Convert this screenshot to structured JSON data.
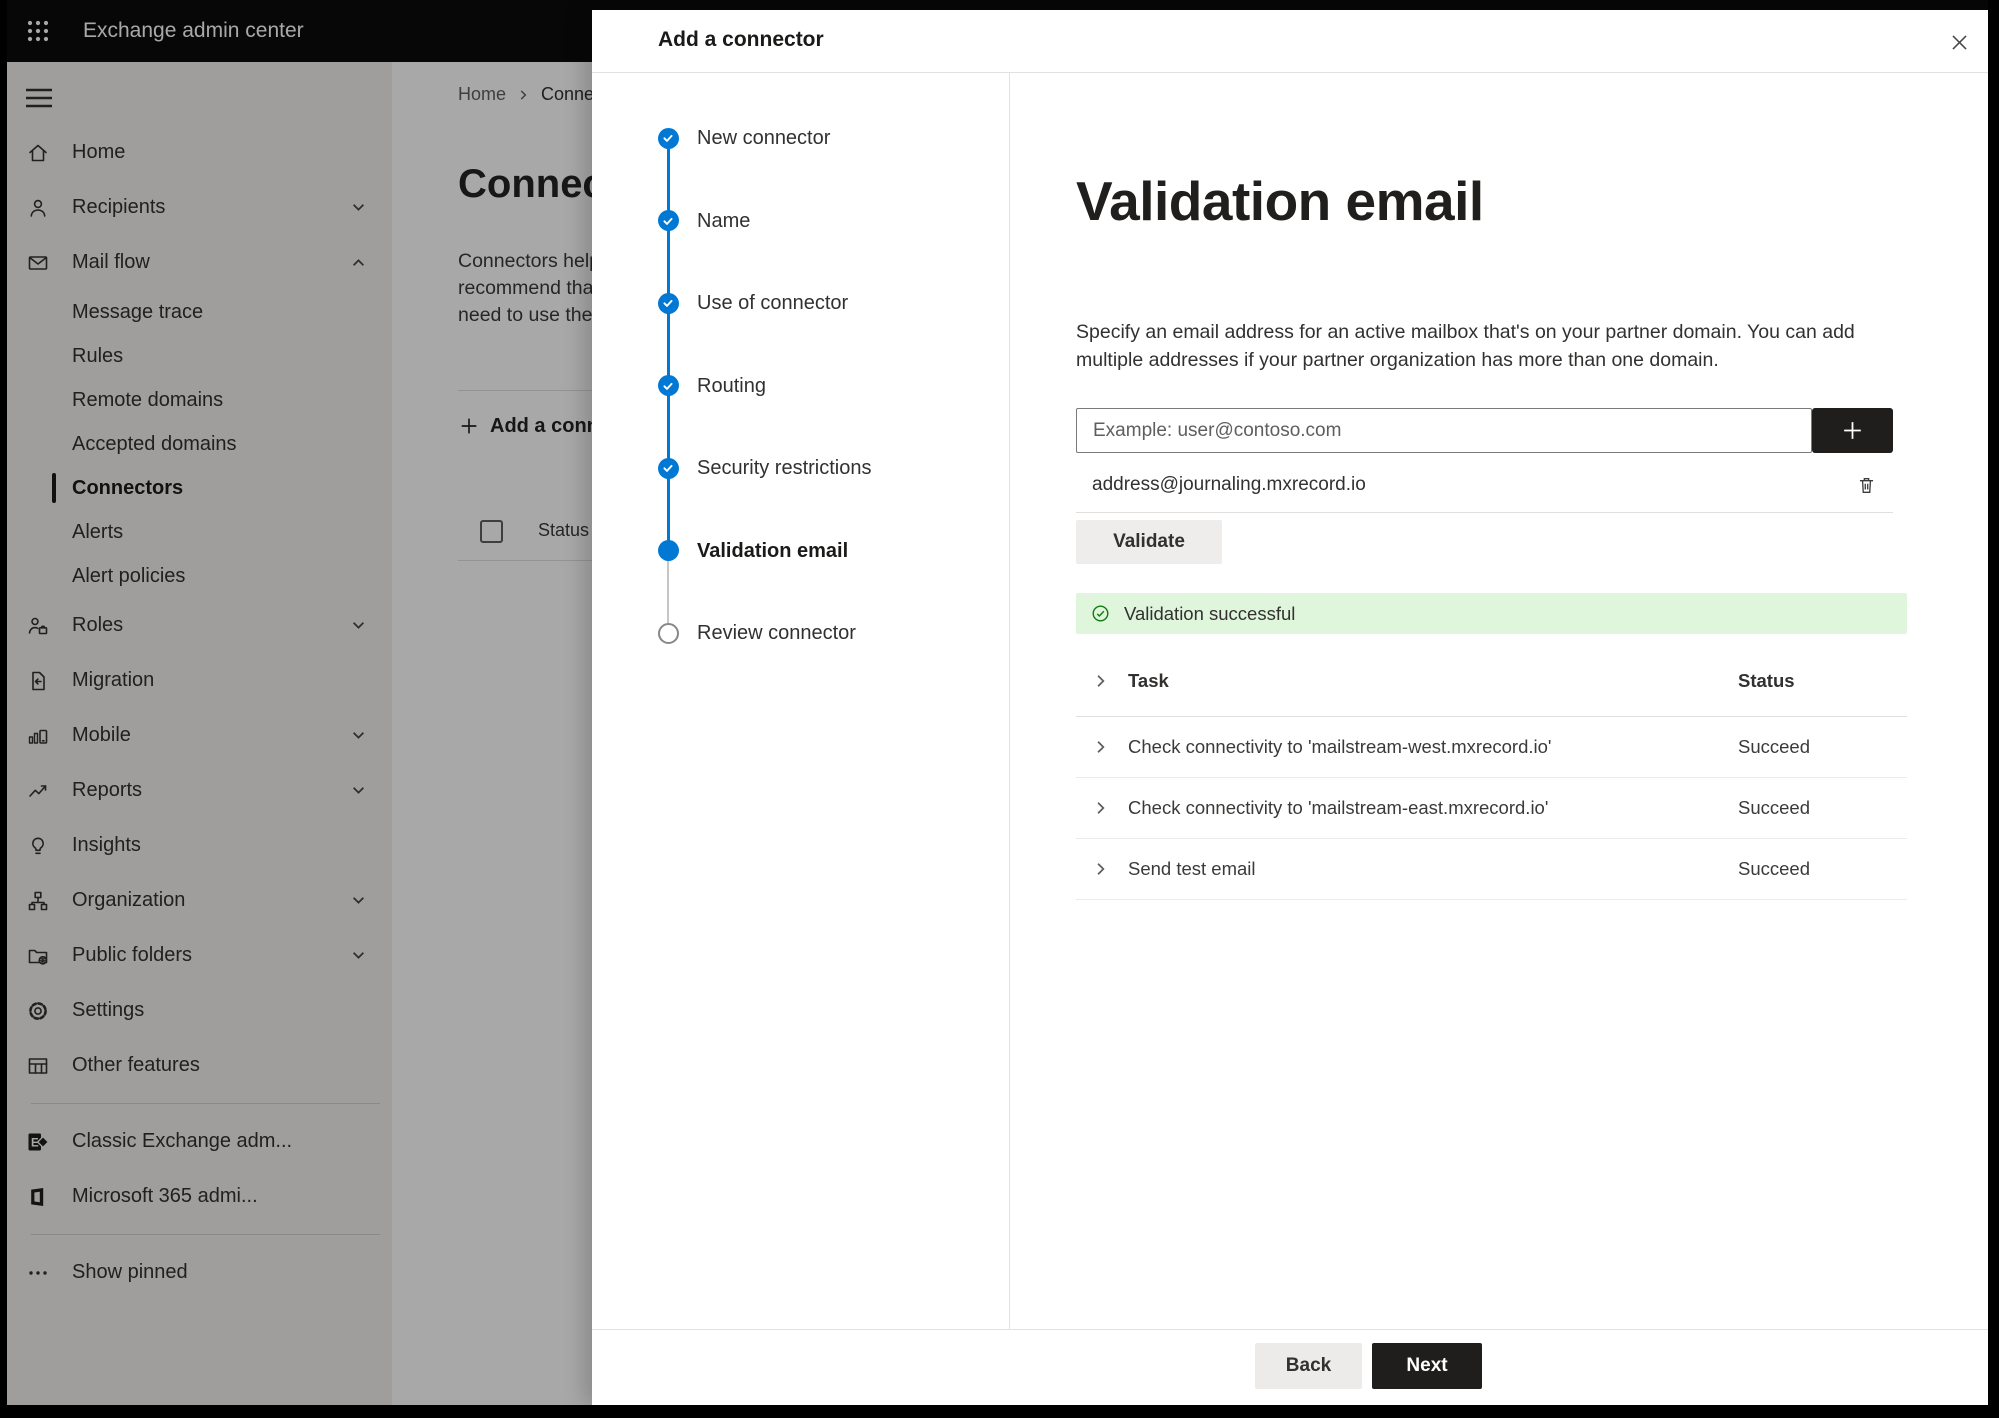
{
  "topbar": {
    "title": "Exchange admin center",
    "app_launcher_icon": "app-launcher-icon"
  },
  "sidebar": {
    "hamburger_icon": "hamburger-icon",
    "items": [
      {
        "label": "Home",
        "icon": "home-icon"
      },
      {
        "label": "Recipients",
        "icon": "recipients-icon",
        "chevron": "down"
      },
      {
        "label": "Mail flow",
        "icon": "mail-flow-icon",
        "chevron": "up"
      },
      {
        "label": "Message trace",
        "sub": true
      },
      {
        "label": "Rules",
        "sub": true
      },
      {
        "label": "Remote domains",
        "sub": true
      },
      {
        "label": "Accepted domains",
        "sub": true
      },
      {
        "label": "Connectors",
        "sub": true,
        "selected": true
      },
      {
        "label": "Alerts",
        "sub": true
      },
      {
        "label": "Alert policies",
        "sub": true
      },
      {
        "label": "Roles",
        "icon": "roles-icon",
        "chevron": "down"
      },
      {
        "label": "Migration",
        "icon": "migration-icon"
      },
      {
        "label": "Mobile",
        "icon": "mobile-icon",
        "chevron": "down"
      },
      {
        "label": "Reports",
        "icon": "reports-icon",
        "chevron": "down"
      },
      {
        "label": "Insights",
        "icon": "insights-icon"
      },
      {
        "label": "Organization",
        "icon": "organization-icon",
        "chevron": "down"
      },
      {
        "label": "Public folders",
        "icon": "public-folders-icon",
        "chevron": "down"
      },
      {
        "label": "Settings",
        "icon": "settings-icon"
      },
      {
        "label": "Other features",
        "icon": "other-features-icon"
      },
      {
        "divider": true
      },
      {
        "label": "Classic Exchange adm...",
        "icon": "classic-exchange-icon"
      },
      {
        "label": "Microsoft 365 admi...",
        "icon": "m365-icon"
      },
      {
        "divider": true
      },
      {
        "label": "Show pinned",
        "icon": "ellipsis-icon"
      }
    ]
  },
  "background_page": {
    "breadcrumb": {
      "home": "Home",
      "current": "Conne"
    },
    "heading": "Connec",
    "paragraph_lines": [
      "Connectors help",
      "recommend tha",
      "need to use ther"
    ],
    "add_button_label": "Add a conn",
    "status_column_label": "Status"
  },
  "panel": {
    "title": "Add a connector",
    "steps": [
      {
        "label": "New connector",
        "state": "done"
      },
      {
        "label": "Name",
        "state": "done"
      },
      {
        "label": "Use of connector",
        "state": "done"
      },
      {
        "label": "Routing",
        "state": "done"
      },
      {
        "label": "Security restrictions",
        "state": "done"
      },
      {
        "label": "Validation email",
        "state": "current"
      },
      {
        "label": "Review connector",
        "state": "todo"
      }
    ],
    "content": {
      "heading": "Validation email",
      "description": "Specify an email address for an active mailbox that's on your partner domain. You can add multiple addresses if your partner organization has more than one domain.",
      "email_input": {
        "value": "",
        "placeholder": "Example: user@contoso.com"
      },
      "addresses": [
        {
          "email": "address@journaling.mxrecord.io"
        }
      ],
      "validate_button": "Validate",
      "banner": {
        "text": "Validation successful"
      },
      "tasks_table": {
        "headers": {
          "task": "Task",
          "status": "Status"
        },
        "rows": [
          {
            "task": "Check connectivity to 'mailstream-west.mxrecord.io'",
            "status": "Succeed"
          },
          {
            "task": "Check connectivity to 'mailstream-east.mxrecord.io'",
            "status": "Succeed"
          },
          {
            "task": "Send test email",
            "status": "Succeed"
          }
        ]
      }
    },
    "footer": {
      "back": "Back",
      "next": "Next"
    }
  },
  "colors": {
    "accent": "#0078d4",
    "success_bg": "#dff6dd",
    "success_fg": "#107c10",
    "primary_button_bg": "#1f1e1d"
  }
}
